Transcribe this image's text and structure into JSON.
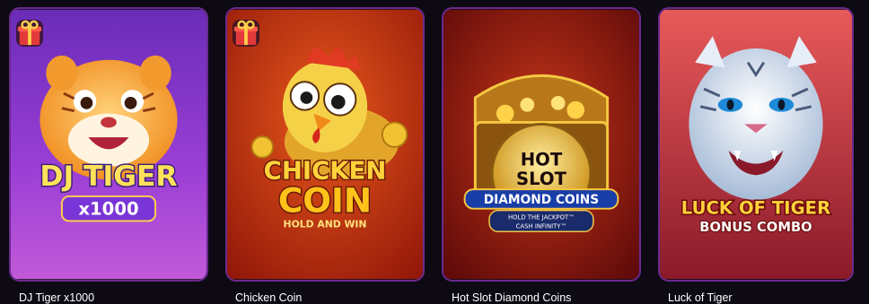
{
  "games": [
    {
      "name": "DJ Tiger x1000",
      "art": {
        "line1": "DJ TIGER",
        "badge": "x1000"
      },
      "has_gift": true
    },
    {
      "name": "Chicken Coin",
      "art": {
        "line1": "CHICKEN",
        "line2": "COIN",
        "badge": "HOLD AND WIN"
      },
      "has_gift": true
    },
    {
      "name": "Hot Slot Diamond Coins",
      "art": {
        "line1": "HOT",
        "line2": "SLOT",
        "line3": "DIAMOND COINS",
        "sub1": "HOLD THE JACKPOT™",
        "sub2": "CASH INFINITY™"
      },
      "has_gift": false
    },
    {
      "name": "Luck of Tiger",
      "art": {
        "line1": "LUCK OF TIGER",
        "line2": "BONUS COMBO"
      },
      "has_gift": false
    }
  ],
  "colors": {
    "background": "#0d0a14",
    "card_border": "#6a2a8e",
    "caption": "#ffffff"
  },
  "icons": {
    "gift": "gift-box-icon"
  }
}
